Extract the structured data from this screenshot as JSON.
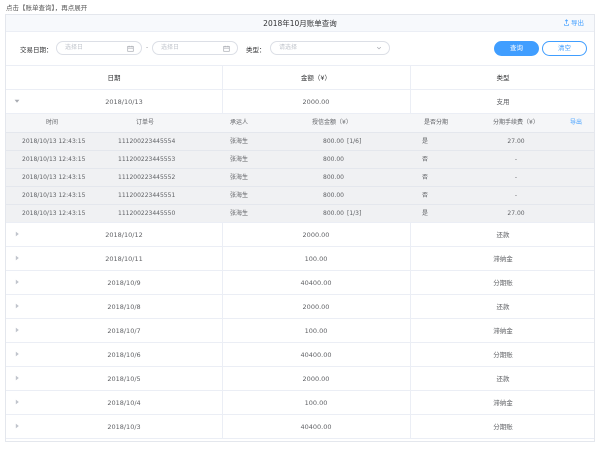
{
  "hint": "点击【账单查询】，再点展开",
  "header": {
    "title": "2018年10月账单查询",
    "export_label": "导出"
  },
  "filter": {
    "date_label": "交易日期：",
    "start_placeholder": "选择日",
    "end_placeholder": "选择日",
    "range_separator": "-",
    "type_label": "类型：",
    "type_placeholder": "请选择",
    "query_label": "查询",
    "clear_label": "清空"
  },
  "table": {
    "columns": [
      "日期",
      "金额（¥）",
      "类型"
    ],
    "expanded_row": {
      "date": "2018/10/13",
      "amount": "2000.00",
      "type": "支用"
    },
    "detail": {
      "columns": [
        "时间",
        "订单号",
        "承运人",
        "授信金额（¥）",
        "是否分期",
        "分期手续费（¥）"
      ],
      "export_label": "导出",
      "rows": [
        {
          "time": "2018/10/13 12:43:15",
          "order": "111200223445554",
          "carrier": "张海生",
          "amount": "800.00",
          "period": "[1/6]",
          "installment": "是",
          "fee": "27.00"
        },
        {
          "time": "2018/10/13 12:43:15",
          "order": "111200223445553",
          "carrier": "张海生",
          "amount": "800.00",
          "period": "",
          "installment": "否",
          "fee": "-"
        },
        {
          "time": "2018/10/13 12:43:15",
          "order": "111200223445552",
          "carrier": "张海生",
          "amount": "800.00",
          "period": "",
          "installment": "否",
          "fee": "-"
        },
        {
          "time": "2018/10/13 12:43:15",
          "order": "111200223445551",
          "carrier": "张海生",
          "amount": "800.00",
          "period": "",
          "installment": "否",
          "fee": "-"
        },
        {
          "time": "2018/10/13 12:43:15",
          "order": "111200223445550",
          "carrier": "张海生",
          "amount": "800.00",
          "period": "[1/3]",
          "installment": "是",
          "fee": "27.00"
        }
      ]
    },
    "rows": [
      {
        "date": "2018/10/12",
        "amount": "2000.00",
        "type": "还款"
      },
      {
        "date": "2018/10/11",
        "amount": "100.00",
        "type": "滞纳金"
      },
      {
        "date": "2018/10/9",
        "amount": "40400.00",
        "type": "分期账"
      },
      {
        "date": "2018/10/8",
        "amount": "2000.00",
        "type": "还款"
      },
      {
        "date": "2018/10/7",
        "amount": "100.00",
        "type": "滞纳金"
      },
      {
        "date": "2018/10/6",
        "amount": "40400.00",
        "type": "分期账"
      },
      {
        "date": "2018/10/5",
        "amount": "2000.00",
        "type": "还款"
      },
      {
        "date": "2018/10/4",
        "amount": "100.00",
        "type": "滞纳金"
      },
      {
        "date": "2018/10/3",
        "amount": "40400.00",
        "type": "分期账"
      }
    ]
  },
  "icons": {
    "export": "export-icon",
    "calendar": "calendar-icon",
    "select": "chevron-down-icon",
    "expand": "caret-right-icon",
    "collapse": "caret-down-icon"
  },
  "colors": {
    "accent": "#409eff",
    "border": "#ebeef5",
    "detail_bg": "#f5f6f8"
  }
}
